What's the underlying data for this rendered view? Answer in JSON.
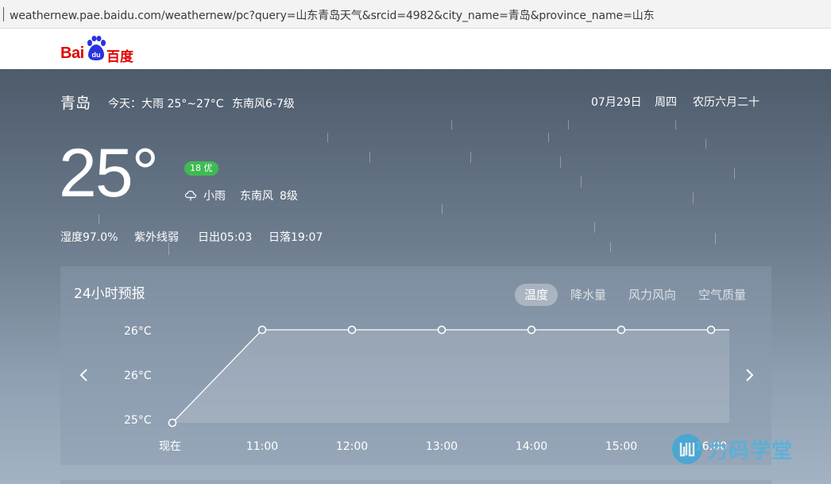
{
  "browser": {
    "url": "weathernew.pae.baidu.com/weathernew/pc?query=山东青岛天气&srcid=4982&city_name=青岛&province_name=山东"
  },
  "logo": {
    "latin": "Bai",
    "paw_text": "du",
    "cn": "百度"
  },
  "header": {
    "city": "青岛",
    "today": "今天：大雨 25°~27°C",
    "wind": "东南风6-7级",
    "date": "07月29日",
    "weekday": "周四",
    "lunar": "农历六月二十"
  },
  "current": {
    "temp": "25°",
    "aqi": "18 优",
    "condition": "小雨",
    "wind_dir": "东南风",
    "wind_level": "8级",
    "condition_icon": "rain-cloud-icon"
  },
  "meta": {
    "humidity": "湿度97.0%",
    "uv": "紫外线弱",
    "sunrise": "日出05:03",
    "sunset": "日落19:07"
  },
  "forecast": {
    "title": "24小时预报",
    "tabs": [
      "温度",
      "降水量",
      "风力风向",
      "空气质量"
    ],
    "active_tab": "温度",
    "y_ticks": [
      "26°C",
      "26°C",
      "25°C"
    ]
  },
  "chart_data": {
    "type": "line",
    "categories": [
      "现在",
      "11:00",
      "12:00",
      "13:00",
      "14:00",
      "15:00",
      "16:00"
    ],
    "values": [
      25,
      26,
      26,
      26,
      26,
      26,
      26
    ],
    "ylim": [
      25,
      26
    ]
  },
  "watermark": {
    "text": "力码学堂"
  },
  "colors": {
    "aqi_good": "#3fba52",
    "baidu_red": "#e10602",
    "baidu_blue": "#2932e1"
  }
}
